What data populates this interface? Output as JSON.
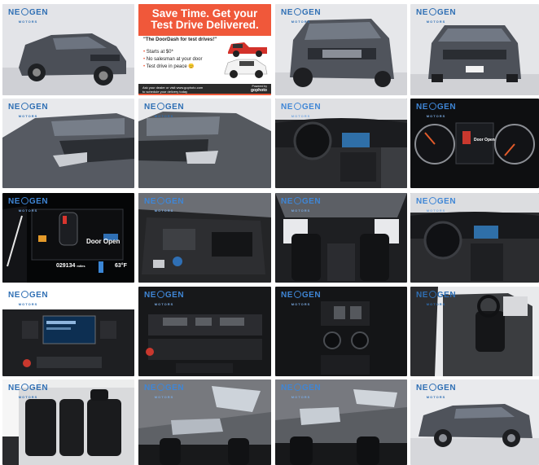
{
  "brand": {
    "name_left": "NE",
    "name_right": "GEN",
    "sub": "MOTORS"
  },
  "ad": {
    "headline_line1": "Save Time. Get your",
    "headline_line2": "Test Drive Delivered.",
    "quote": "\"The DoorDash for test drives!\"",
    "bullets": [
      "Starts at $0*",
      "No salesman at your door",
      "Test drive in peace 😊"
    ],
    "footer_line1": "Ask your dealer or visit www.gophoto.com",
    "footer_line2": "to schedule your delivery today",
    "powered_by": "Powered by",
    "provider": "gophoto"
  },
  "dash": {
    "door_open": "Door Open",
    "odometer": "029134",
    "odo_unit": "miles",
    "temp": "63°F",
    "small_door_open": "Door Open"
  },
  "gallery": [
    {
      "label": "exterior-front-three-quarter"
    },
    {
      "label": "test-drive-ad"
    },
    {
      "label": "exterior-front-angle"
    },
    {
      "label": "exterior-front"
    },
    {
      "label": "headlight-left"
    },
    {
      "label": "headlight-right"
    },
    {
      "label": "dashboard-overview"
    },
    {
      "label": "instrument-cluster"
    },
    {
      "label": "cluster-detail"
    },
    {
      "label": "engine-bay"
    },
    {
      "label": "rear-cabin-view"
    },
    {
      "label": "cockpit-view"
    },
    {
      "label": "infotainment-screen"
    },
    {
      "label": "climate-controls"
    },
    {
      "label": "center-console"
    },
    {
      "label": "front-seats-door-open"
    },
    {
      "label": "rear-seats"
    },
    {
      "label": "sunroof-1"
    },
    {
      "label": "sunroof-2"
    },
    {
      "label": "exterior-side"
    }
  ]
}
